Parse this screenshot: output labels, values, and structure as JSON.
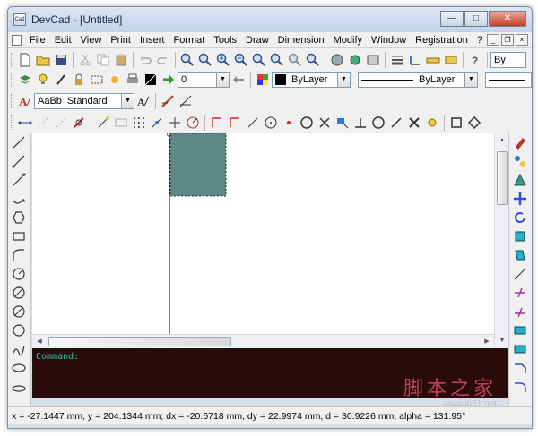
{
  "window": {
    "title": "DevCad - [Untitled]",
    "icon_label": "Cad",
    "min_glyph": "—",
    "max_glyph": "□",
    "close_glyph": "✕"
  },
  "menubar": {
    "items": [
      "File",
      "Edit",
      "View",
      "Print",
      "Insert",
      "Format",
      "Tools",
      "Draw",
      "Dimension",
      "Modify",
      "Window",
      "Registration",
      "?"
    ],
    "mdi_min": "_",
    "mdi_restore": "❐",
    "mdi_close": "×"
  },
  "toolbar": {
    "layer_value": "0",
    "color_value": "ByLayer",
    "linetype_value": "ByLayer",
    "textstyle_label": "AaBb",
    "textstyle_value": "Standard",
    "overflow_label": "By"
  },
  "command": {
    "prompt": "Command:"
  },
  "watermark": {
    "text": "脚本之家",
    "url": "www.jb51.net"
  },
  "status": {
    "coords": "x = -27.1447 mm, y = 204.1344 mm; dx = -20.6718 mm, dy = 22.9974 mm, d = 30.9226 mm, alpha = 131.95°"
  },
  "colors": {
    "command_bg": "#2b0a0a",
    "command_text": "#29c7a3",
    "selected_shape": "#5b8a87",
    "titlebar": "#c2d3ea"
  }
}
